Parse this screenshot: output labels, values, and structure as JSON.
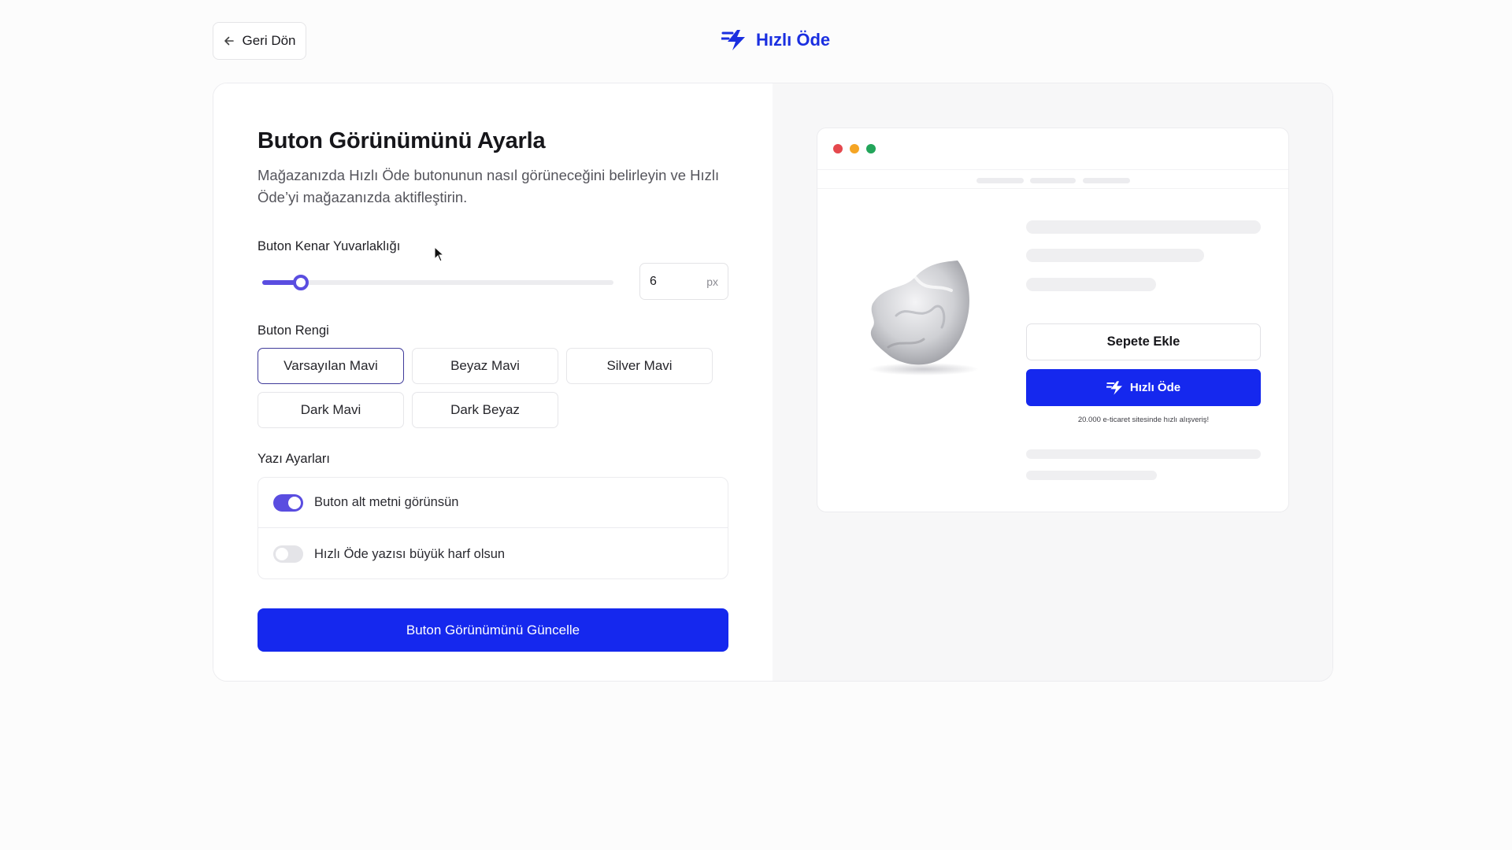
{
  "header": {
    "back_label": "Geri Dön",
    "brand_name": "Hızlı Öde",
    "brand_color": "#1a2fe0"
  },
  "settings": {
    "title": "Buton Görünümünü Ayarla",
    "subtitle": "Mağazanızda Hızlı Öde butonunun nasıl görüneceğini belirleyin ve Hızlı Öde’yi mağazanızda aktifleştirin.",
    "radius": {
      "label": "Buton Kenar Yuvarlaklığı",
      "value": "6",
      "unit": "px",
      "slider_fraction": 0.11
    },
    "color": {
      "label": "Buton Rengi",
      "options": [
        "Varsayılan Mavi",
        "Beyaz Mavi",
        "Silver Mavi",
        "Dark Mavi",
        "Dark Beyaz"
      ],
      "selected": "Varsayılan Mavi"
    },
    "text_settings": {
      "label": "Yazı Ayarları",
      "toggles": [
        {
          "label": "Buton alt metni görünsün",
          "on": true
        },
        {
          "label": "Hızlı Öde yazısı büyük harf olsun",
          "on": false
        }
      ]
    },
    "update_label": "Buton Görünümünü Güncelle",
    "accent_color": "#5a4de0",
    "primary_color": "#1528ee"
  },
  "preview": {
    "add_to_cart_label": "Sepete Ekle",
    "fast_pay_label": "Hızlı Öde",
    "subtext": "20.000 e-ticaret sitesinde hızlı alışveriş!",
    "window_dots": [
      "#e5484d",
      "#f5a524",
      "#22a55a"
    ]
  }
}
